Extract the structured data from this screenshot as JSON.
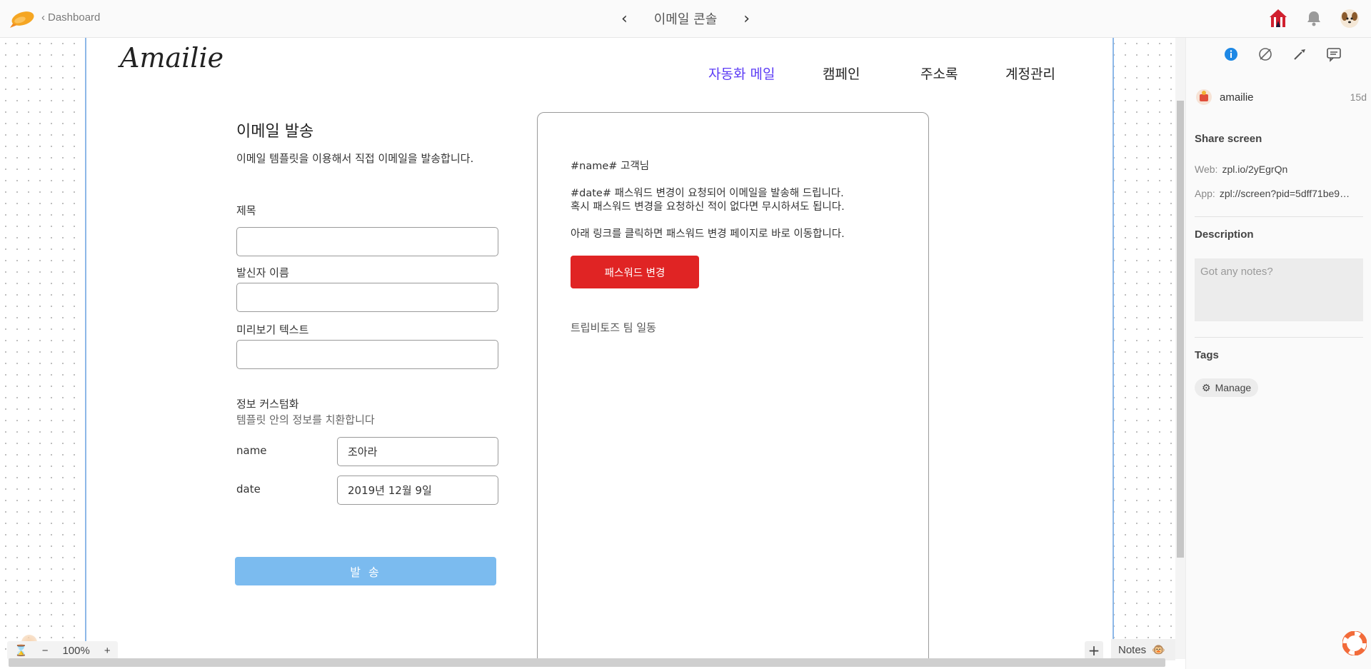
{
  "topbar": {
    "back_label": "Dashboard",
    "screen_title": "이메일 콘솔",
    "prev_icon": "chevron-left-icon",
    "next_icon": "chevron-right-icon"
  },
  "site": {
    "brand": "Amailie",
    "nav": [
      "자동화 메일",
      "캠페인",
      "주소록",
      "계정관리"
    ],
    "active_color": "#5c3cf5"
  },
  "form": {
    "title": "이메일 발송",
    "subtitle": "이메일 템플릿을 이용해서 직접 이메일을 발송합니다.",
    "subject_label": "제목",
    "subject_value": "",
    "sender_label": "발신자 이름",
    "sender_value": "",
    "preview_label": "미리보기 텍스트",
    "preview_value": "",
    "custom_title": "정보 커스텀화",
    "custom_sub": "템플릿 안의 정보를 치환합니다",
    "fields": [
      {
        "key": "name",
        "value": "조아라"
      },
      {
        "key": "date",
        "value": "2019년 12월 9일"
      }
    ],
    "send_label": "발 송"
  },
  "email_preview": {
    "greeting": "#name# 고객님",
    "line1": "#date# 패스워드 변경이 요청되어 이메일을 발송해 드립니다.",
    "line2": "혹시 패스워드 변경을 요청하신 적이 없다면 무시하셔도 됩니다.",
    "line3": "아래 링크를 클릭하면 패스워드 변경 페이지로 바로 이동합니다.",
    "button": "패스워드 변경",
    "signature": "트립비토즈 팀 일동",
    "button_color": "#e02424"
  },
  "bottom": {
    "zoom_minus": "−",
    "zoom_value": "100%",
    "zoom_plus": "+",
    "add": "+",
    "notes": "Notes"
  },
  "sidepanel": {
    "user": "amailie",
    "age": "15d",
    "share_title": "Share screen",
    "web_label": "Web:",
    "web_value": "zpl.io/2yEgrQn",
    "app_label": "App:",
    "app_value": "zpl://screen?pid=5dff71be9…",
    "description_title": "Description",
    "notes_placeholder": "Got any notes?",
    "tags_title": "Tags",
    "manage_label": "Manage",
    "info_color": "#1e88e5"
  }
}
